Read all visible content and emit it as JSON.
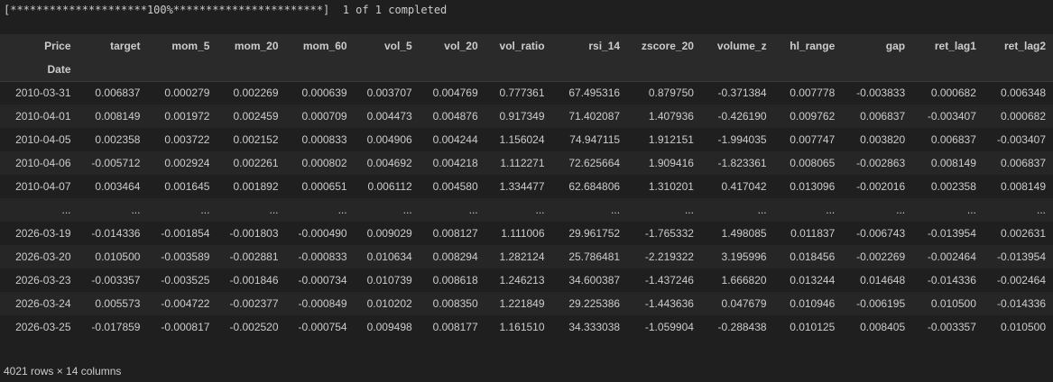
{
  "progress": {
    "bar": "[*********************100%***********************]",
    "status": "1 of 1 completed"
  },
  "table": {
    "index_header": "Price",
    "index_name": "Date",
    "columns": [
      "target",
      "mom_5",
      "mom_20",
      "mom_60",
      "vol_5",
      "vol_20",
      "vol_ratio",
      "rsi_14",
      "zscore_20",
      "volume_z",
      "hl_range",
      "gap",
      "ret_lag1",
      "ret_lag2"
    ],
    "rows": [
      {
        "date": "2010-03-31",
        "values": [
          "0.006837",
          "0.000279",
          "0.002269",
          "0.000639",
          "0.003707",
          "0.004769",
          "0.777361",
          "67.495316",
          "0.879750",
          "-0.371384",
          "0.007778",
          "-0.003833",
          "0.000682",
          "0.006348"
        ]
      },
      {
        "date": "2010-04-01",
        "values": [
          "0.008149",
          "0.001972",
          "0.002459",
          "0.000709",
          "0.004473",
          "0.004876",
          "0.917349",
          "71.402087",
          "1.407936",
          "-0.426190",
          "0.009762",
          "0.006837",
          "-0.003407",
          "0.000682"
        ]
      },
      {
        "date": "2010-04-05",
        "values": [
          "0.002358",
          "0.003722",
          "0.002152",
          "0.000833",
          "0.004906",
          "0.004244",
          "1.156024",
          "74.947115",
          "1.912151",
          "-1.994035",
          "0.007747",
          "0.003820",
          "0.006837",
          "-0.003407"
        ]
      },
      {
        "date": "2010-04-06",
        "values": [
          "-0.005712",
          "0.002924",
          "0.002261",
          "0.000802",
          "0.004692",
          "0.004218",
          "1.112271",
          "72.625664",
          "1.909416",
          "-1.823361",
          "0.008065",
          "-0.002863",
          "0.008149",
          "0.006837"
        ]
      },
      {
        "date": "2010-04-07",
        "values": [
          "0.003464",
          "0.001645",
          "0.001892",
          "0.000651",
          "0.006112",
          "0.004580",
          "1.334477",
          "62.684806",
          "1.310201",
          "0.417042",
          "0.013096",
          "-0.002016",
          "0.002358",
          "0.008149"
        ]
      },
      {
        "date": "...",
        "values": [
          "...",
          "...",
          "...",
          "...",
          "...",
          "...",
          "...",
          "...",
          "...",
          "...",
          "...",
          "...",
          "...",
          "..."
        ]
      },
      {
        "date": "2026-03-19",
        "values": [
          "-0.014336",
          "-0.001854",
          "-0.001803",
          "-0.000490",
          "0.009029",
          "0.008127",
          "1.111006",
          "29.961752",
          "-1.765332",
          "1.498085",
          "0.011837",
          "-0.006743",
          "-0.013954",
          "0.002631"
        ]
      },
      {
        "date": "2026-03-20",
        "values": [
          "0.010500",
          "-0.003589",
          "-0.002881",
          "-0.000833",
          "0.010634",
          "0.008294",
          "1.282124",
          "25.786481",
          "-2.219322",
          "3.195996",
          "0.018456",
          "-0.002269",
          "-0.002464",
          "-0.013954"
        ]
      },
      {
        "date": "2026-03-23",
        "values": [
          "-0.003357",
          "-0.003525",
          "-0.001846",
          "-0.000734",
          "0.010739",
          "0.008618",
          "1.246213",
          "34.600387",
          "-1.437246",
          "1.666820",
          "0.013244",
          "0.014648",
          "-0.014336",
          "-0.002464"
        ]
      },
      {
        "date": "2026-03-24",
        "values": [
          "0.005573",
          "-0.004722",
          "-0.002377",
          "-0.000849",
          "0.010202",
          "0.008350",
          "1.221849",
          "29.225386",
          "-1.443636",
          "0.047679",
          "0.010946",
          "-0.006195",
          "0.010500",
          "-0.014336"
        ]
      },
      {
        "date": "2026-03-25",
        "values": [
          "-0.017859",
          "-0.000817",
          "-0.002520",
          "-0.000754",
          "0.009498",
          "0.008177",
          "1.161510",
          "34.333038",
          "-1.059904",
          "-0.288438",
          "0.010125",
          "0.008405",
          "-0.003357",
          "0.010500"
        ]
      }
    ]
  },
  "footer": {
    "summary": "4021 rows × 14 columns"
  }
}
